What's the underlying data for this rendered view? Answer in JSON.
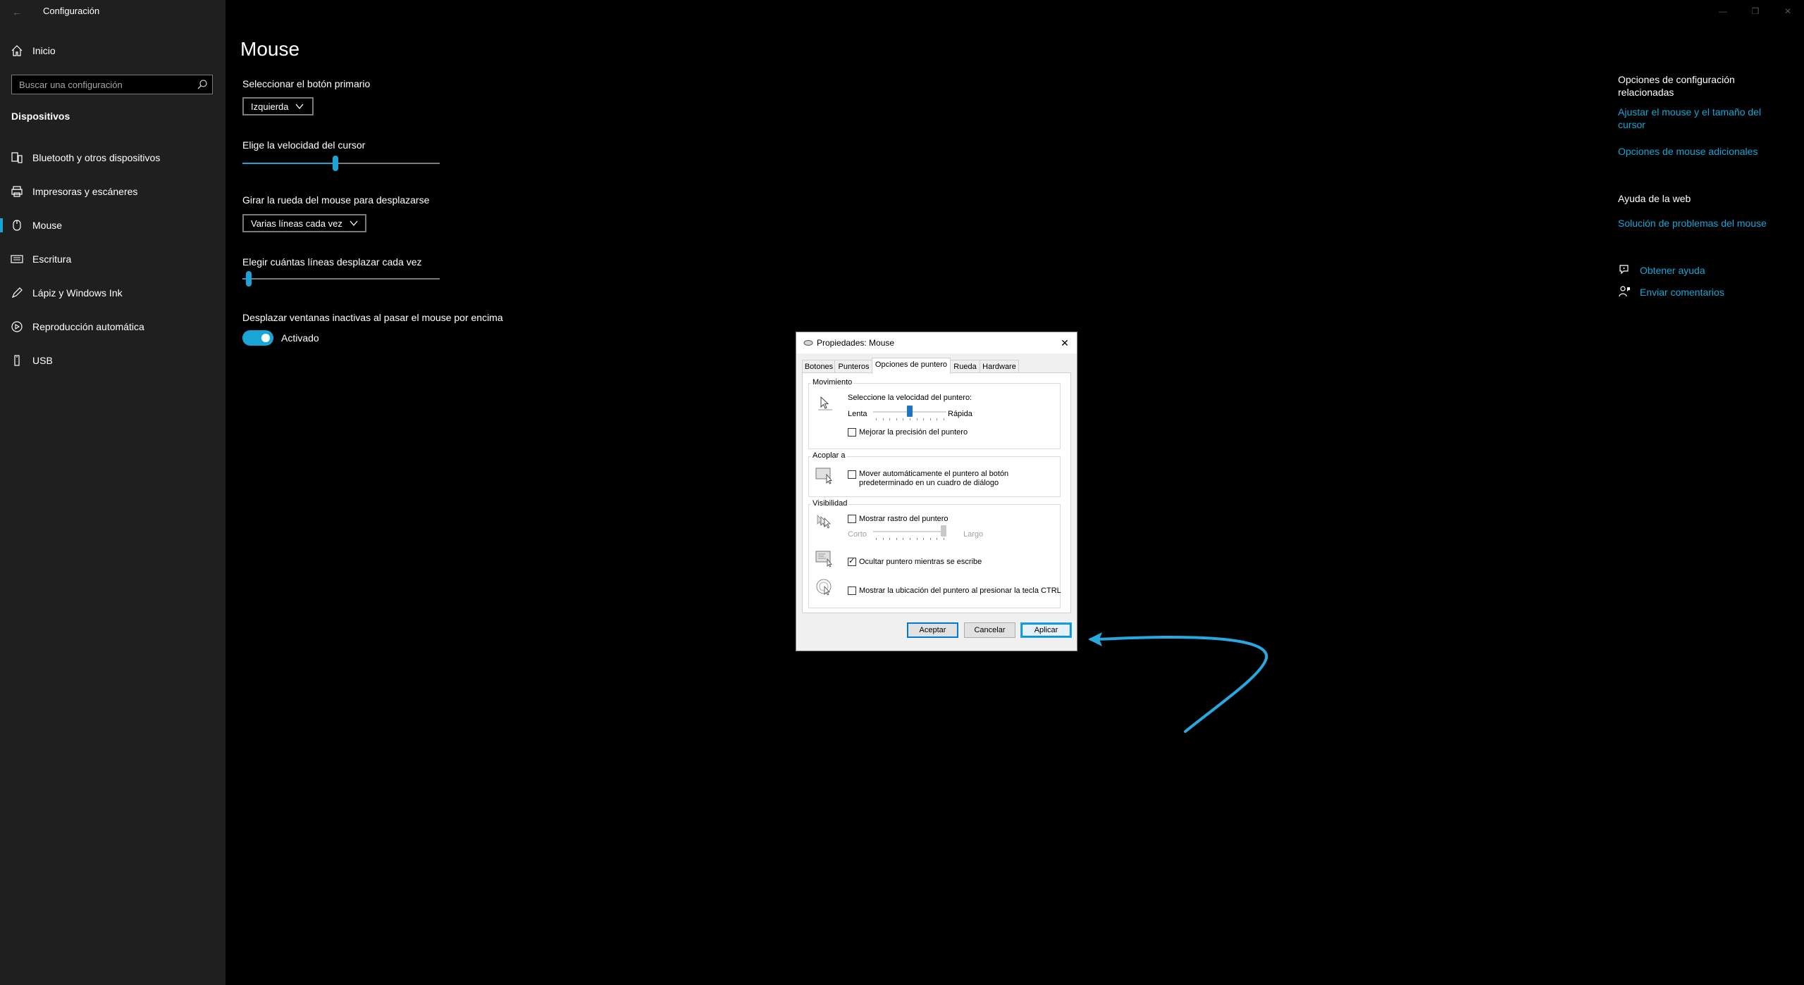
{
  "app": {
    "title": "Configuración",
    "back_glyph": "←"
  },
  "sidebar": {
    "home_label": "Inicio",
    "search_placeholder": "Buscar una configuración",
    "section_title": "Dispositivos",
    "items": [
      {
        "label": "Bluetooth y otros dispositivos",
        "icon": "bluetooth-icon"
      },
      {
        "label": "Impresoras y escáneres",
        "icon": "printer-icon"
      },
      {
        "label": "Mouse",
        "icon": "mouse-icon",
        "active": true
      },
      {
        "label": "Escritura",
        "icon": "keyboard-icon"
      },
      {
        "label": "Lápiz y Windows Ink",
        "icon": "pen-icon"
      },
      {
        "label": "Reproducción automática",
        "icon": "autoplay-icon"
      },
      {
        "label": "USB",
        "icon": "usb-icon"
      }
    ]
  },
  "main": {
    "title": "Mouse",
    "primary_button": {
      "label": "Seleccionar el botón primario",
      "value": "Izquierda"
    },
    "cursor_speed": {
      "label": "Elige la velocidad del cursor",
      "value_fraction": 0.47
    },
    "scroll_wheel": {
      "label": "Girar la rueda del mouse para desplazarse",
      "value": "Varias líneas cada vez"
    },
    "scroll_lines": {
      "label": "Elegir cuántas líneas desplazar cada vez",
      "value_fraction": 0.02
    },
    "inactive_scroll": {
      "label": "Desplazar ventanas inactivas al pasar el mouse por encima",
      "toggle_state": "Activado",
      "on": true
    }
  },
  "related": {
    "heading": "Opciones de configuración relacionadas",
    "heading_line1": "Opciones de configuración",
    "heading_line2": "relacionadas",
    "link1_line1": "Ajustar el mouse y el tamaño del",
    "link1_line2": "cursor",
    "link2": "Opciones de mouse adicionales",
    "web_heading": "Ayuda de la web",
    "web_link": "Solución de problemas del mouse",
    "help_link": "Obtener ayuda",
    "feedback_link": "Enviar comentarios"
  },
  "window_controls": {
    "minimize": "—",
    "maximize": "❐",
    "close": "✕"
  },
  "dialog": {
    "title": "Propiedades: Mouse",
    "close_glyph": "✕",
    "tabs": [
      "Botones",
      "Punteros",
      "Opciones de puntero",
      "Rueda",
      "Hardware"
    ],
    "active_tab": "Opciones de puntero",
    "movement": {
      "group_title": "Movimiento",
      "speed_label": "Seleccione la velocidad del puntero:",
      "slow": "Lenta",
      "fast": "Rápida",
      "speed_fraction": 0.5,
      "precision_label": "Mejorar la precisión del puntero",
      "precision_checked": false
    },
    "snap": {
      "group_title": "Acoplar a",
      "label_line1": "Mover automáticamente el puntero al botón",
      "label_line2": "predeterminado en un cuadro de diálogo",
      "checked": false
    },
    "visibility": {
      "group_title": "Visibilidad",
      "trail_label": "Mostrar rastro del puntero",
      "trail_checked": false,
      "short": "Corto",
      "long": "Largo",
      "trail_fraction": 1.0,
      "hide_label": "Ocultar puntero mientras se escribe",
      "hide_checked": true,
      "ctrl_label": "Mostrar la ubicación del puntero al presionar la tecla CTRL",
      "ctrl_checked": false
    },
    "buttons": {
      "ok": "Aceptar",
      "cancel": "Cancelar",
      "apply": "Aplicar"
    }
  },
  "colors": {
    "accent": "#1aa5d6",
    "sidebar_bg": "#1f1f1f",
    "page_bg": "#000000",
    "arrow": "#29a8e0"
  }
}
